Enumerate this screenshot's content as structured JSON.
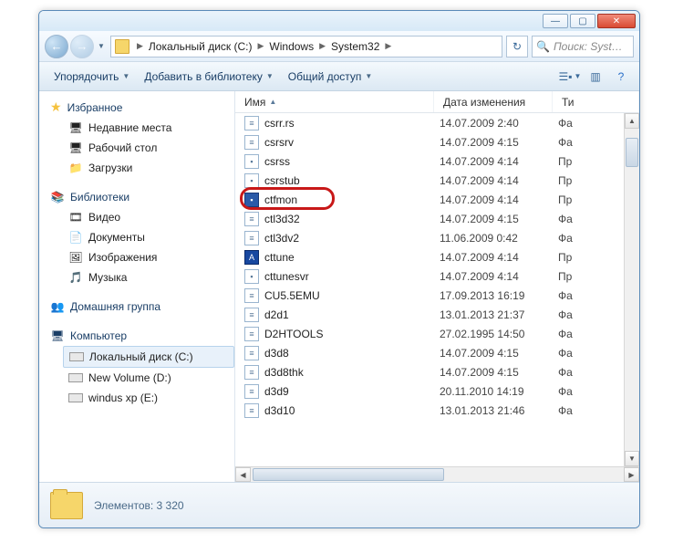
{
  "breadcrumb": {
    "segments": [
      "Локальный диск (C:)",
      "Windows",
      "System32"
    ]
  },
  "search": {
    "placeholder": "Поиск: Syst…"
  },
  "toolbar": {
    "organize": "Упорядочить",
    "include": "Добавить в библиотеку",
    "share": "Общий доступ"
  },
  "nav": {
    "favorites": {
      "label": "Избранное",
      "items": [
        "Недавние места",
        "Рабочий стол",
        "Загрузки"
      ]
    },
    "libraries": {
      "label": "Библиотеки",
      "items": [
        "Видео",
        "Документы",
        "Изображения",
        "Музыка"
      ]
    },
    "homegroup": {
      "label": "Домашняя группа"
    },
    "computer": {
      "label": "Компьютер",
      "items": [
        "Локальный диск (C:)",
        "New Volume (D:)",
        "windus xp (E:)"
      ]
    }
  },
  "columns": {
    "name": "Имя",
    "date": "Дата изменения",
    "type": "Ти"
  },
  "files": [
    {
      "name": "csrr.rs",
      "date": "14.07.2009 2:40",
      "type": "Фа",
      "icon": "doc"
    },
    {
      "name": "csrsrv",
      "date": "14.07.2009 4:15",
      "type": "Фа",
      "icon": "doc"
    },
    {
      "name": "csrss",
      "date": "14.07.2009 4:14",
      "type": "Пр",
      "icon": "app"
    },
    {
      "name": "csrstub",
      "date": "14.07.2009 4:14",
      "type": "Пр",
      "icon": "app"
    },
    {
      "name": "ctfmon",
      "date": "14.07.2009 4:14",
      "type": "Пр",
      "icon": "app",
      "highlight": true
    },
    {
      "name": "ctl3d32",
      "date": "14.07.2009 4:15",
      "type": "Фа",
      "icon": "doc"
    },
    {
      "name": "ctl3dv2",
      "date": "11.06.2009 0:42",
      "type": "Фа",
      "icon": "doc"
    },
    {
      "name": "cttune",
      "date": "14.07.2009 4:14",
      "type": "Пр",
      "icon": "font"
    },
    {
      "name": "cttunesvr",
      "date": "14.07.2009 4:14",
      "type": "Пр",
      "icon": "app"
    },
    {
      "name": "CU5.5EMU",
      "date": "17.09.2013 16:19",
      "type": "Фа",
      "icon": "doc"
    },
    {
      "name": "d2d1",
      "date": "13.01.2013 21:37",
      "type": "Фа",
      "icon": "doc"
    },
    {
      "name": "D2HTOOLS",
      "date": "27.02.1995 14:50",
      "type": "Фа",
      "icon": "doc"
    },
    {
      "name": "d3d8",
      "date": "14.07.2009 4:15",
      "type": "Фа",
      "icon": "doc"
    },
    {
      "name": "d3d8thk",
      "date": "14.07.2009 4:15",
      "type": "Фа",
      "icon": "doc"
    },
    {
      "name": "d3d9",
      "date": "20.11.2010 14:19",
      "type": "Фа",
      "icon": "doc"
    },
    {
      "name": "d3d10",
      "date": "13.01.2013 21:46",
      "type": "Фа",
      "icon": "doc"
    }
  ],
  "status": {
    "text": "Элементов: 3 320"
  }
}
